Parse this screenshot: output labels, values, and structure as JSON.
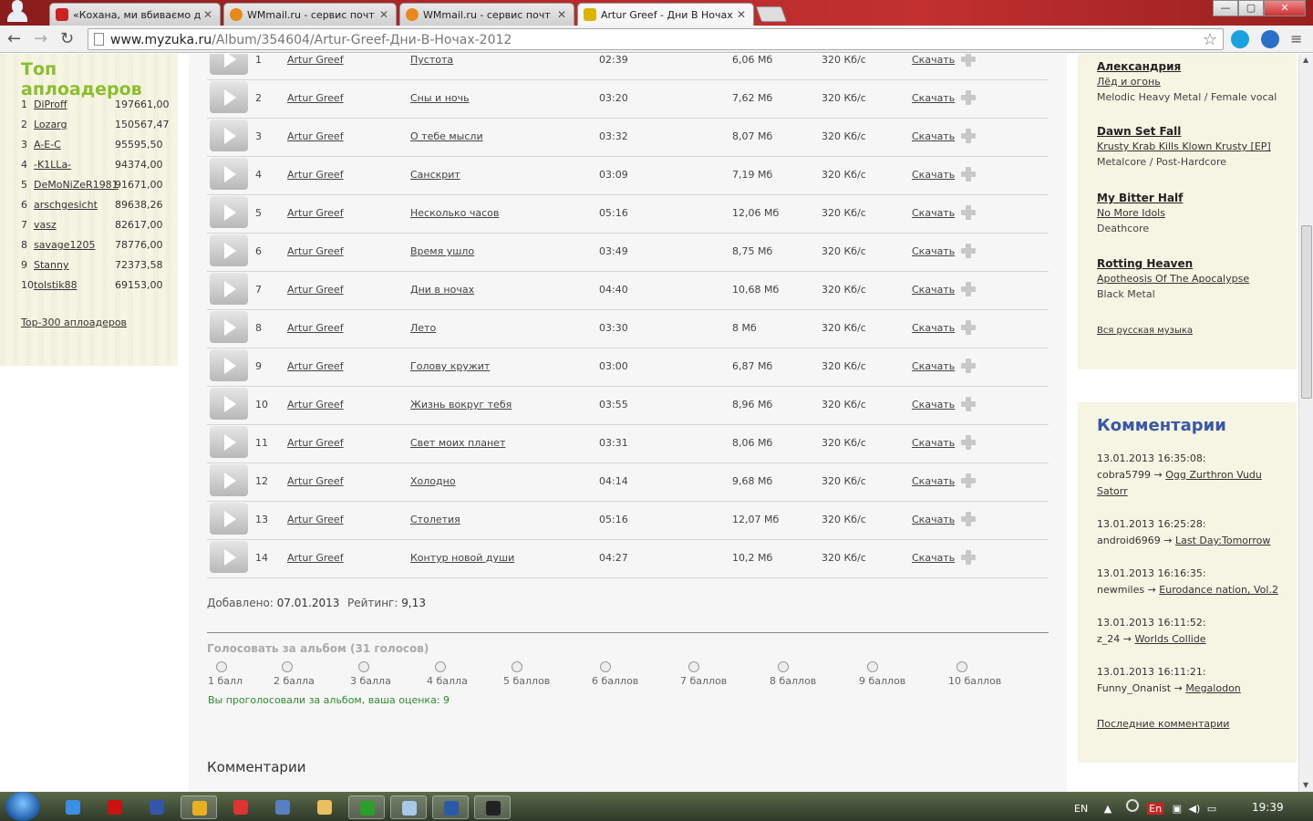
{
  "browser": {
    "tabs": [
      {
        "title": "«Кохана, ми вбиваємо ді",
        "favicon_color": "#cc2222"
      },
      {
        "title": "WMmail.ru - сервис почт",
        "favicon_color": "#e8891c"
      },
      {
        "title": "WMmail.ru - сервис почт",
        "favicon_color": "#e8891c"
      },
      {
        "title": "Artur Greef - Дни В Ночах",
        "favicon_color": "#d9b400"
      }
    ],
    "url_host": "www.myzuka.ru",
    "url_path": "/Album/354604/Artur-Greef-Дни-В-Ночах-2012"
  },
  "uploaders": {
    "title": "Топ аплоадеров",
    "rows": [
      {
        "rank": "1",
        "name": "DiProff",
        "value": "197661,00"
      },
      {
        "rank": "2",
        "name": "Lozarg",
        "value": "150567,47"
      },
      {
        "rank": "3",
        "name": "A-E-C",
        "value": "95595,50"
      },
      {
        "rank": "4",
        "name": "-K1LLa-",
        "value": "94374,00"
      },
      {
        "rank": "5",
        "name": "DeMoNiZeR1981",
        "value": "91671,00"
      },
      {
        "rank": "6",
        "name": "arschgesicht",
        "value": "89638,26"
      },
      {
        "rank": "7",
        "name": "vasz",
        "value": "82617,00"
      },
      {
        "rank": "8",
        "name": "savage1205",
        "value": "78776,00"
      },
      {
        "rank": "9",
        "name": "Stanny",
        "value": "72373,58"
      },
      {
        "rank": "10",
        "name": "tolstik88",
        "value": "69153,00"
      }
    ],
    "top300_link": "Top-300 аплоадеров"
  },
  "tracks": [
    {
      "num": "1",
      "artist": "Artur Greef",
      "title": "Пустота",
      "duration": "02:39",
      "size": "6,06 Мб",
      "bitrate": "320 Кб/с",
      "download": "Скачать"
    },
    {
      "num": "2",
      "artist": "Artur Greef",
      "title": "Сны и ночь",
      "duration": "03:20",
      "size": "7,62 Мб",
      "bitrate": "320 Кб/с",
      "download": "Скачать"
    },
    {
      "num": "3",
      "artist": "Artur Greef",
      "title": "О тебе мысли",
      "duration": "03:32",
      "size": "8,07 Мб",
      "bitrate": "320 Кб/с",
      "download": "Скачать"
    },
    {
      "num": "4",
      "artist": "Artur Greef",
      "title": "Санскрит",
      "duration": "03:09",
      "size": "7,19 Мб",
      "bitrate": "320 Кб/с",
      "download": "Скачать"
    },
    {
      "num": "5",
      "artist": "Artur Greef",
      "title": "Несколько часов",
      "duration": "05:16",
      "size": "12,06 Мб",
      "bitrate": "320 Кб/с",
      "download": "Скачать"
    },
    {
      "num": "6",
      "artist": "Artur Greef",
      "title": "Время ушло",
      "duration": "03:49",
      "size": "8,75 Мб",
      "bitrate": "320 Кб/с",
      "download": "Скачать"
    },
    {
      "num": "7",
      "artist": "Artur Greef",
      "title": "Дни в ночах",
      "duration": "04:40",
      "size": "10,68 Мб",
      "bitrate": "320 Кб/с",
      "download": "Скачать"
    },
    {
      "num": "8",
      "artist": "Artur Greef",
      "title": "Лето",
      "duration": "03:30",
      "size": "8 Мб",
      "bitrate": "320 Кб/с",
      "download": "Скачать"
    },
    {
      "num": "9",
      "artist": "Artur Greef",
      "title": "Голову кружит",
      "duration": "03:00",
      "size": "6,87 Мб",
      "bitrate": "320 Кб/с",
      "download": "Скачать"
    },
    {
      "num": "10",
      "artist": "Artur Greef",
      "title": "Жизнь вокруг тебя",
      "duration": "03:55",
      "size": "8,96 Мб",
      "bitrate": "320 Кб/с",
      "download": "Скачать"
    },
    {
      "num": "11",
      "artist": "Artur Greef",
      "title": "Свет моих планет",
      "duration": "03:31",
      "size": "8,06 Мб",
      "bitrate": "320 Кб/с",
      "download": "Скачать"
    },
    {
      "num": "12",
      "artist": "Artur Greef",
      "title": "Холодно",
      "duration": "04:14",
      "size": "9,68 Мб",
      "bitrate": "320 Кб/с",
      "download": "Скачать"
    },
    {
      "num": "13",
      "artist": "Artur Greef",
      "title": "Столетия",
      "duration": "05:16",
      "size": "12,07 Мб",
      "bitrate": "320 Кб/с",
      "download": "Скачать"
    },
    {
      "num": "14",
      "artist": "Artur Greef",
      "title": "Контур новой души",
      "duration": "04:27",
      "size": "10,2 Мб",
      "bitrate": "320 Кб/с",
      "download": "Скачать"
    }
  ],
  "album_info": {
    "added_label": "Добавлено:",
    "added_date": "07.01.2013",
    "rating_label": "Рейтинг:",
    "rating_value": "9,13"
  },
  "vote": {
    "title": "Голосовать за альбом (31 голосов)",
    "options": [
      "1 балл",
      "2 балла",
      "3 балла",
      "4 балла",
      "5 баллов",
      "6 баллов",
      "7 баллов",
      "8 баллов",
      "9 баллов",
      "10 баллов"
    ],
    "voted_message": "Вы проголосовали за альбом, ваша оценка: 9"
  },
  "comments_heading": "Комментарии",
  "right_releases": [
    {
      "band": "Александрия",
      "album": "Лёд и огонь",
      "genre": "Melodic Heavy Metal / Female vocal"
    },
    {
      "band": "Dawn Set Fall",
      "album": "Krusty Krab Kills Klown Krusty [EP]",
      "genre": "Metalcore / Post-Hardcore"
    },
    {
      "band": "My Bitter Half",
      "album": "No More Idols",
      "genre": "Deathcore"
    },
    {
      "band": "Rotting Heaven",
      "album": "Apotheosis Of The Apocalypse",
      "genre": "Black Metal"
    }
  ],
  "all_russian_link": "Вся русская музыка",
  "comments_panel": {
    "title": "Комментарии",
    "items": [
      {
        "date": "13.01.2013 16:35:08:",
        "user": "cobra5799",
        "arrow": "→",
        "target": "Ogg Zurthron Vudu Satorr"
      },
      {
        "date": "13.01.2013 16:25:28:",
        "user": "android6969",
        "arrow": "→",
        "target": "Last Day:Tomorrow"
      },
      {
        "date": "13.01.2013 16:16:35:",
        "user": "newmiles",
        "arrow": "→",
        "target": "Eurodance nation, Vol.2"
      },
      {
        "date": "13.01.2013 16:11:52:",
        "user": "z_24",
        "arrow": "→",
        "target": "Worlds Collide"
      },
      {
        "date": "13.01.2013 16:11:21:",
        "user": "Funny_Onanist",
        "arrow": "→",
        "target": "Megalodon"
      }
    ],
    "last_link": "Последние комментарии"
  },
  "taskbar": {
    "lang": "EN",
    "lang2": "En",
    "time": "19:39",
    "apps": [
      {
        "icon": "ie-icon",
        "color": "#3a8ee6"
      },
      {
        "icon": "opera-icon",
        "color": "#cc1111"
      },
      {
        "icon": "floppy-icon",
        "color": "#3355aa"
      },
      {
        "icon": "chrome-icon",
        "color": "#e8b020"
      },
      {
        "icon": "yandex-icon",
        "color": "#dd3333"
      },
      {
        "icon": "mail-icon",
        "color": "#5a7fc0"
      },
      {
        "icon": "folder-icon",
        "color": "#e8c060"
      },
      {
        "icon": "utorrent-icon",
        "color": "#2aa02a"
      },
      {
        "icon": "notepad-icon",
        "color": "#a8c8e8"
      },
      {
        "icon": "word-icon",
        "color": "#2b5aa8"
      },
      {
        "icon": "font-icon",
        "color": "#222222"
      }
    ]
  }
}
